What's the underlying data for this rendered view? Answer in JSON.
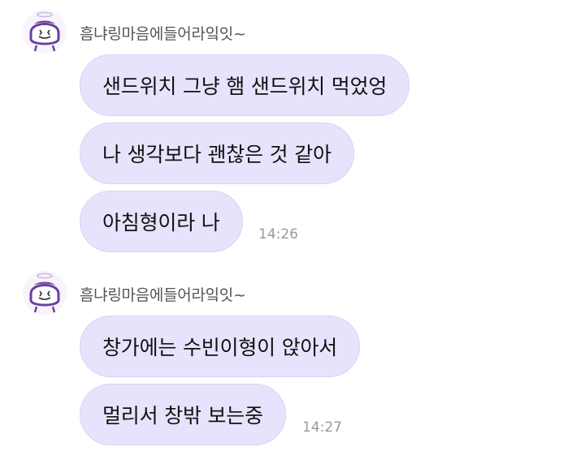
{
  "groups": [
    {
      "sender": "흠냐링마음에들어라잌잇~",
      "messages": [
        "샌드위치 그냥 햄 샌드위치 먹었엉",
        "나 생각보다 괜찮은 것 같아",
        "아침형이라 나"
      ],
      "time": "14:26"
    },
    {
      "sender": "흠냐링마음에들어라잌잇~",
      "messages": [
        "창가에는 수빈이형이 앉아서",
        "멀리서 창밖 보는중"
      ],
      "time": "14:27"
    }
  ],
  "colors": {
    "bubble": "#e6e4fc",
    "bubble_border": "#d6d2f4",
    "sender_text": "#555555",
    "time_text": "#999999"
  },
  "avatar_icon": "cartoon-character-icon"
}
